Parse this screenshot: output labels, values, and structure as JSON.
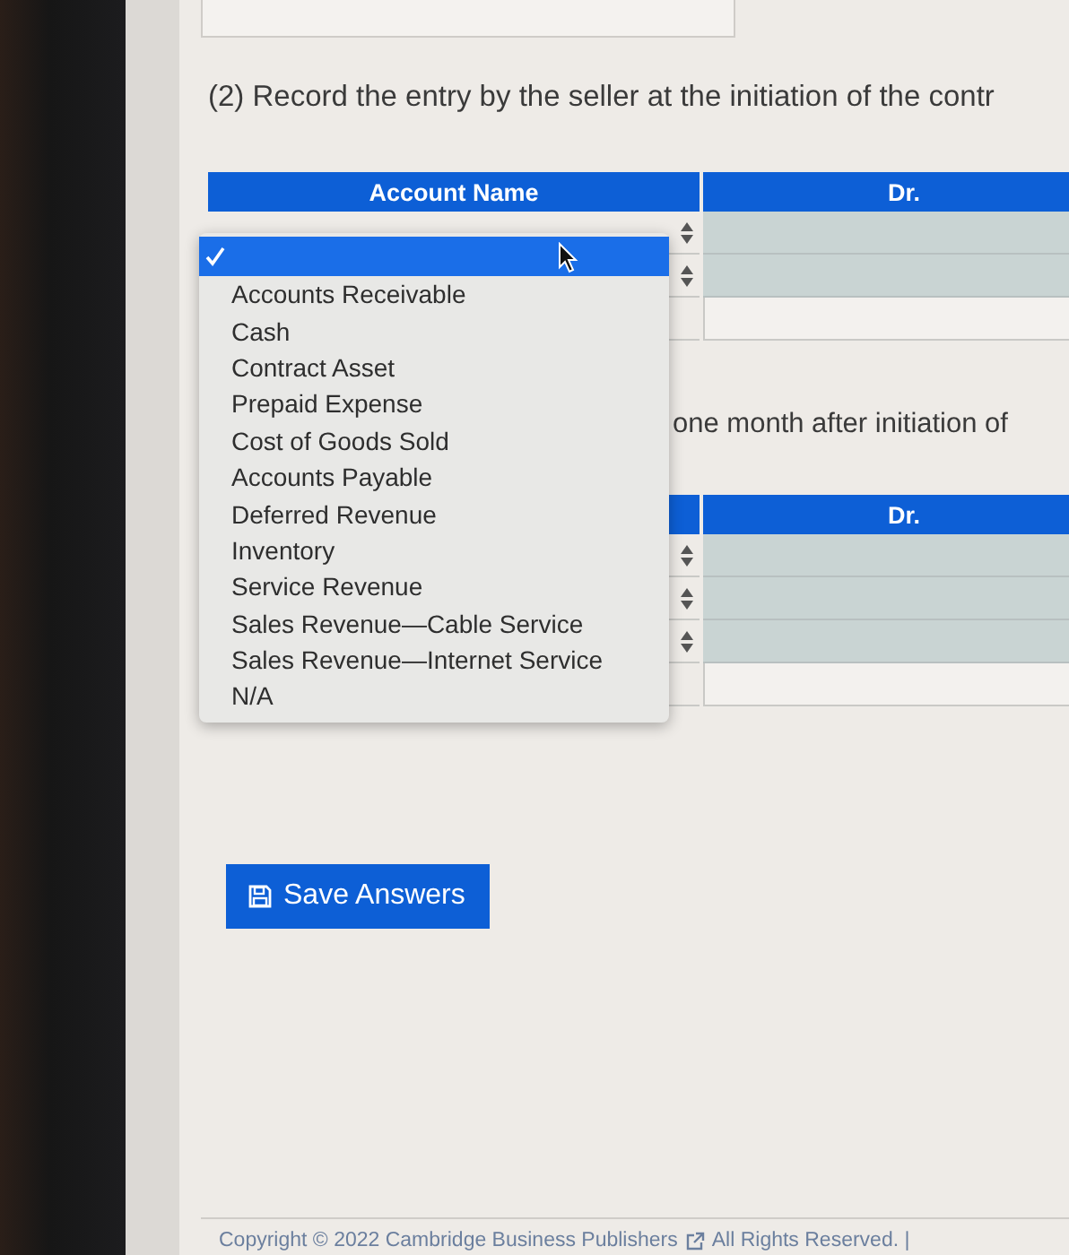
{
  "question": "(2) Record the entry by the seller at the initiation of the contr",
  "tables": [
    {
      "account_label": "Account Name",
      "dr_label": "Dr.",
      "rows": [
        {
          "kind": "select"
        },
        {
          "kind": "select"
        },
        {
          "kind": "blank"
        }
      ]
    },
    {
      "dr_label": "Dr.",
      "rows": [
        {
          "kind": "select"
        },
        {
          "kind": "select"
        },
        {
          "kind": "select"
        },
        {
          "kind": "blank"
        }
      ]
    }
  ],
  "partial_question": "one month after initiation of",
  "dropdown": {
    "options": [
      {
        "selected": true
      },
      {
        "label": "Accounts Receivable",
        "selected": false
      },
      {
        "label": "Cash",
        "selected": false
      },
      {
        "label": "Contract Asset",
        "selected": false
      },
      {
        "label": "Prepaid Expense",
        "selected": false
      },
      {
        "label": "Cost of Goods Sold",
        "selected": false
      },
      {
        "label": "Accounts Payable",
        "selected": false
      },
      {
        "label": "Deferred Revenue",
        "selected": false
      },
      {
        "label": "Inventory",
        "selected": false
      },
      {
        "label": "Service Revenue",
        "selected": false
      },
      {
        "label": "Sales Revenue—Cable Service",
        "selected": false
      },
      {
        "label": "Sales Revenue—Internet Service",
        "selected": false
      },
      {
        "label": "N/A",
        "selected": false
      }
    ]
  },
  "save_button": "Save Answers",
  "footer": {
    "copyright": "Copyright © 2022 Cambridge Business Publishers",
    "rights": "All Rights Reserved. |"
  }
}
